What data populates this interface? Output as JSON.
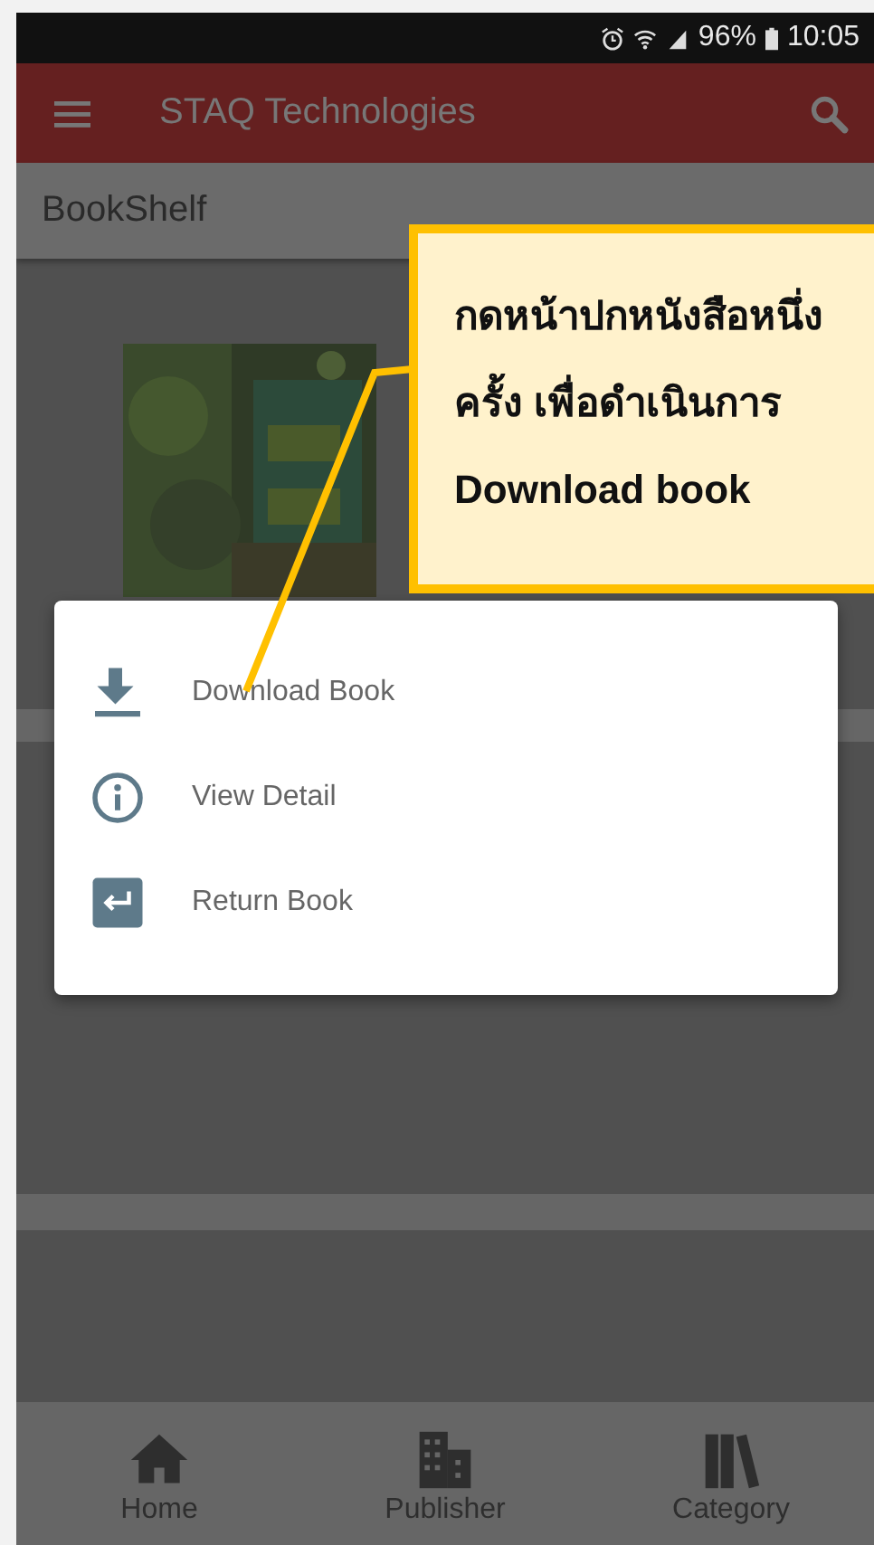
{
  "status_bar": {
    "battery": "96%",
    "time": "10:05"
  },
  "app_bar": {
    "title": "STAQ Technologies"
  },
  "section": {
    "title": "BookShelf"
  },
  "menu": {
    "items": [
      {
        "kind": "download",
        "label": "Download Book"
      },
      {
        "kind": "info",
        "label": "View Detail"
      },
      {
        "kind": "return",
        "label": "Return Book"
      }
    ]
  },
  "callout": {
    "lines": [
      "กดหน้าปกหนังสือหนึ่ง",
      "ครั้ง เพื่อดำเนินการ",
      "Download book"
    ]
  },
  "bottom_nav": [
    {
      "kind": "home",
      "label": "Home"
    },
    {
      "kind": "publisher",
      "label": "Publisher"
    },
    {
      "kind": "category",
      "label": "Category"
    }
  ]
}
